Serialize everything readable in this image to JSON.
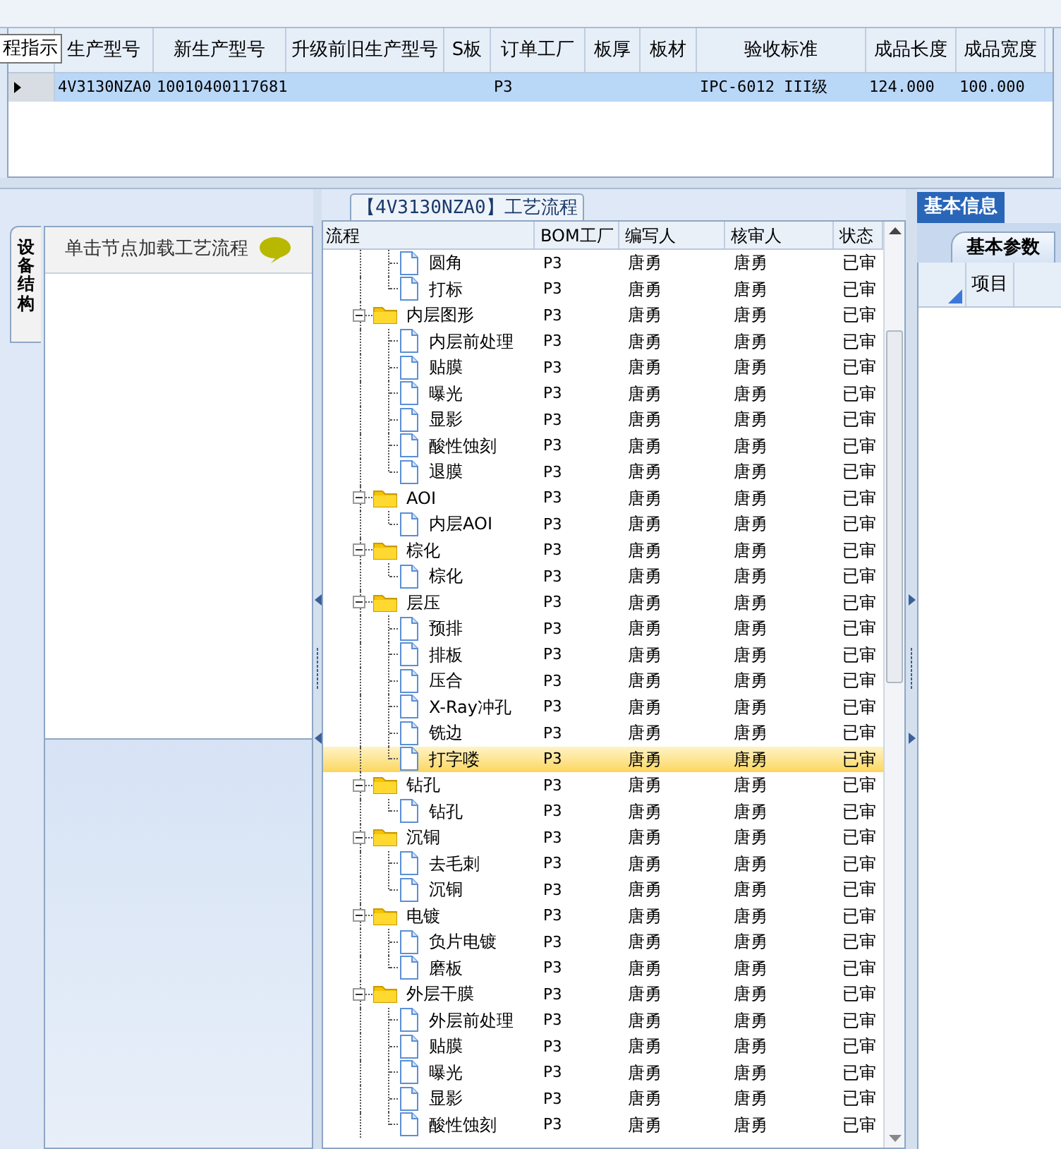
{
  "order_table": {
    "tooltip": "程指示",
    "columns": [
      "生产型号",
      "新生产型号",
      "升级前旧生产型号",
      "S板",
      "订单工厂",
      "板厚",
      "板材",
      "验收标准",
      "成品长度",
      "成品宽度"
    ],
    "rows": [
      {
        "selected": true,
        "cells": [
          "4V3130NZA0",
          "10010400117681",
          "",
          "",
          "P3",
          "",
          "",
          "IPC-6012 III级",
          "124.000",
          "100.000"
        ]
      }
    ]
  },
  "side_tab": {
    "label": "设备结构",
    "selected": true
  },
  "device_panel": {
    "hint": "单击节点加载工艺流程"
  },
  "flow_panel": {
    "title": "【4V3130NZA0】工艺流程",
    "columns": [
      "流程",
      "BOM工厂",
      "编写人",
      "核审人",
      "状态"
    ],
    "rows": [
      {
        "kind": "continued",
        "children": [
          {
            "label": "圆角",
            "bom": "P3",
            "author": "唐勇",
            "reviewer": "唐勇",
            "status": "已审",
            "selected": false
          },
          {
            "label": "打标",
            "bom": "P3",
            "author": "唐勇",
            "reviewer": "唐勇",
            "status": "已审",
            "selected": false
          }
        ]
      },
      {
        "kind": "group",
        "label": "内层图形",
        "bom": "P3",
        "author": "唐勇",
        "reviewer": "唐勇",
        "status": "已审",
        "selected": false,
        "expanded": true,
        "children": [
          {
            "label": "内层前处理",
            "bom": "P3",
            "author": "唐勇",
            "reviewer": "唐勇",
            "status": "已审",
            "selected": false
          },
          {
            "label": "贴膜",
            "bom": "P3",
            "author": "唐勇",
            "reviewer": "唐勇",
            "status": "已审",
            "selected": false
          },
          {
            "label": "曝光",
            "bom": "P3",
            "author": "唐勇",
            "reviewer": "唐勇",
            "status": "已审",
            "selected": false
          },
          {
            "label": "显影",
            "bom": "P3",
            "author": "唐勇",
            "reviewer": "唐勇",
            "status": "已审",
            "selected": false
          },
          {
            "label": "酸性蚀刻",
            "bom": "P3",
            "author": "唐勇",
            "reviewer": "唐勇",
            "status": "已审",
            "selected": false
          },
          {
            "label": "退膜",
            "bom": "P3",
            "author": "唐勇",
            "reviewer": "唐勇",
            "status": "已审",
            "selected": false
          }
        ]
      },
      {
        "kind": "group",
        "label": "AOI",
        "bom": "P3",
        "author": "唐勇",
        "reviewer": "唐勇",
        "status": "已审",
        "selected": false,
        "expanded": true,
        "children": [
          {
            "label": "内层AOI",
            "bom": "P3",
            "author": "唐勇",
            "reviewer": "唐勇",
            "status": "已审",
            "selected": false
          }
        ]
      },
      {
        "kind": "group",
        "label": "棕化",
        "bom": "P3",
        "author": "唐勇",
        "reviewer": "唐勇",
        "status": "已审",
        "selected": false,
        "expanded": true,
        "children": [
          {
            "label": "棕化",
            "bom": "P3",
            "author": "唐勇",
            "reviewer": "唐勇",
            "status": "已审",
            "selected": false
          }
        ]
      },
      {
        "kind": "group",
        "label": "层压",
        "bom": "P3",
        "author": "唐勇",
        "reviewer": "唐勇",
        "status": "已审",
        "selected": false,
        "expanded": true,
        "children": [
          {
            "label": "预排",
            "bom": "P3",
            "author": "唐勇",
            "reviewer": "唐勇",
            "status": "已审",
            "selected": false
          },
          {
            "label": "排板",
            "bom": "P3",
            "author": "唐勇",
            "reviewer": "唐勇",
            "status": "已审",
            "selected": false
          },
          {
            "label": "压合",
            "bom": "P3",
            "author": "唐勇",
            "reviewer": "唐勇",
            "status": "已审",
            "selected": false
          },
          {
            "label": "X-Ray冲孔",
            "bom": "P3",
            "author": "唐勇",
            "reviewer": "唐勇",
            "status": "已审",
            "selected": false
          },
          {
            "label": "铣边",
            "bom": "P3",
            "author": "唐勇",
            "reviewer": "唐勇",
            "status": "已审",
            "selected": false
          },
          {
            "label": "打字喽",
            "bom": "P3",
            "author": "唐勇",
            "reviewer": "唐勇",
            "status": "已审",
            "selected": true
          }
        ]
      },
      {
        "kind": "group",
        "label": "钻孔",
        "bom": "P3",
        "author": "唐勇",
        "reviewer": "唐勇",
        "status": "已审",
        "selected": false,
        "expanded": true,
        "children": [
          {
            "label": "钻孔",
            "bom": "P3",
            "author": "唐勇",
            "reviewer": "唐勇",
            "status": "已审",
            "selected": false
          }
        ]
      },
      {
        "kind": "group",
        "label": "沉铜",
        "bom": "P3",
        "author": "唐勇",
        "reviewer": "唐勇",
        "status": "已审",
        "selected": false,
        "expanded": true,
        "children": [
          {
            "label": "去毛刺",
            "bom": "P3",
            "author": "唐勇",
            "reviewer": "唐勇",
            "status": "已审",
            "selected": false
          },
          {
            "label": "沉铜",
            "bom": "P3",
            "author": "唐勇",
            "reviewer": "唐勇",
            "status": "已审",
            "selected": false
          }
        ]
      },
      {
        "kind": "group",
        "label": "电镀",
        "bom": "P3",
        "author": "唐勇",
        "reviewer": "唐勇",
        "status": "已审",
        "selected": false,
        "expanded": true,
        "children": [
          {
            "label": "负片电镀",
            "bom": "P3",
            "author": "唐勇",
            "reviewer": "唐勇",
            "status": "已审",
            "selected": false
          },
          {
            "label": "磨板",
            "bom": "P3",
            "author": "唐勇",
            "reviewer": "唐勇",
            "status": "已审",
            "selected": false
          }
        ]
      },
      {
        "kind": "group",
        "label": "外层干膜",
        "bom": "P3",
        "author": "唐勇",
        "reviewer": "唐勇",
        "status": "已审",
        "selected": false,
        "expanded": true,
        "children": [
          {
            "label": "外层前处理",
            "bom": "P3",
            "author": "唐勇",
            "reviewer": "唐勇",
            "status": "已审",
            "selected": false
          },
          {
            "label": "贴膜",
            "bom": "P3",
            "author": "唐勇",
            "reviewer": "唐勇",
            "status": "已审",
            "selected": false
          },
          {
            "label": "曝光",
            "bom": "P3",
            "author": "唐勇",
            "reviewer": "唐勇",
            "status": "已审",
            "selected": false
          },
          {
            "label": "显影",
            "bom": "P3",
            "author": "唐勇",
            "reviewer": "唐勇",
            "status": "已审",
            "selected": false
          },
          {
            "label": "酸性蚀刻",
            "bom": "P3",
            "author": "唐勇",
            "reviewer": "唐勇",
            "status": "已审",
            "selected": false
          }
        ]
      }
    ]
  },
  "info_panel": {
    "tabs": [
      {
        "label": "基本信息",
        "selected": true
      }
    ],
    "sub_tabs": [
      {
        "label": "基本参数",
        "selected": true
      }
    ],
    "columns": [
      "项目"
    ]
  }
}
